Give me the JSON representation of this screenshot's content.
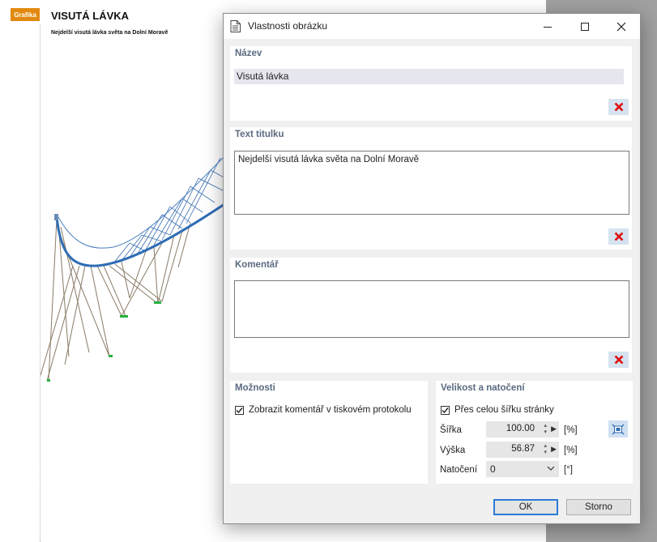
{
  "report": {
    "tag": "Grafika",
    "title": "VISUTÁ LÁVKA",
    "subtitle": "Nejdelší visutá lávka světa na Dolní Moravě"
  },
  "dialog": {
    "title": "Vlastnosti obrázku",
    "name_section": {
      "heading": "Název",
      "value": "Visutá lávka"
    },
    "caption_section": {
      "heading": "Text titulku",
      "value": "Nejdelší visutá lávka světa na Dolní Moravě"
    },
    "comment_section": {
      "heading": "Komentář",
      "value": ""
    },
    "options_section": {
      "heading": "Možnosti",
      "show_comment": {
        "label": "Zobrazit komentář v tiskovém protokolu",
        "checked": true
      }
    },
    "size_section": {
      "heading": "Velikost a natočení",
      "full_width": {
        "label": "Přes celou šířku stránky",
        "checked": true
      },
      "width": {
        "label": "Šířka",
        "value": "100.00",
        "unit": "[%]"
      },
      "height": {
        "label": "Výška",
        "value": "56.87",
        "unit": "[%]"
      },
      "rotation": {
        "label": "Natočení",
        "value": "0",
        "unit": "[°]"
      }
    },
    "ok_label": "OK",
    "cancel_label": "Storno"
  },
  "colors": {
    "tag_orange": "#e28a10",
    "section_heading": "#5a6a80",
    "delete_red": "#e01010",
    "ok_border": "#2c7ad6"
  },
  "icons": [
    "document-icon",
    "minimize-icon",
    "maximize-icon",
    "close-icon",
    "delete-icon",
    "fit-size-icon",
    "checkmark-icon",
    "chevron-down-icon"
  ]
}
